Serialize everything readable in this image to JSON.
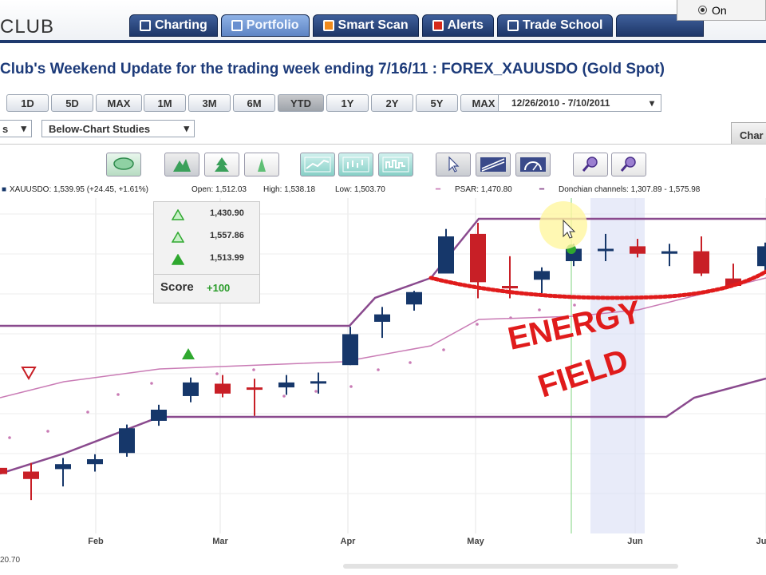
{
  "app": {
    "logo": "CLUB"
  },
  "nav": {
    "tabs": [
      {
        "label": "Charting",
        "active": false
      },
      {
        "label": "Portfolio",
        "active": true
      },
      {
        "label": "Smart Scan",
        "active": false
      },
      {
        "label": "Alerts",
        "active": false
      },
      {
        "label": "Trade School",
        "active": false
      }
    ],
    "corner_option": "On"
  },
  "page": {
    "title": "Club's Weekend Update for the trading week ending 7/16/11 : FOREX_XAUUSDO (Gold Spot)"
  },
  "range_buttons_left": [
    "1D",
    "5D",
    "MAX"
  ],
  "range_buttons": [
    {
      "label": "1M",
      "active": false
    },
    {
      "label": "3M",
      "active": false
    },
    {
      "label": "6M",
      "active": false
    },
    {
      "label": "YTD",
      "active": true
    },
    {
      "label": "1Y",
      "active": false
    },
    {
      "label": "2Y",
      "active": false
    },
    {
      "label": "5Y",
      "active": false
    },
    {
      "label": "MAX",
      "active": false
    }
  ],
  "date_range": "12/26/2010 - 7/10/2011",
  "studies": {
    "above": "s",
    "below": "Below-Chart Studies"
  },
  "side_tab": "Char",
  "legend": {
    "symbol": "XAUUSDO: 1,539.95 (+24.45, +1.61%)",
    "open": "Open: 1,512.03",
    "high": "High: 1,538.18",
    "low": "Low: 1,503.70",
    "psar": "PSAR: 1,470.80",
    "donchian": "Donchian channels: 1,307.89 - 1,575.98"
  },
  "score_panel": {
    "rows": [
      "1,430.90",
      "1,557.86",
      "1,513.99"
    ],
    "label": "Score",
    "value": "+100"
  },
  "annotation": {
    "line1": "ENERGY",
    "line2": "FIELD"
  },
  "colors": {
    "nav": "#1d3668",
    "up": "#16376a",
    "down": "#c81f26",
    "psar": "#c97bb5",
    "donchian": "#8a4a8e",
    "annotation": "#e01b1b"
  },
  "chart_data": {
    "type": "candlestick",
    "x_ticks": [
      "Feb",
      "Mar",
      "Apr",
      "May",
      "Jun",
      "Ju"
    ],
    "bottom_value": "20.70",
    "candles": [
      {
        "o": 1333,
        "h": 1345,
        "l": 1318,
        "c": 1328
      },
      {
        "o": 1330,
        "h": 1337,
        "l": 1307,
        "c": 1324
      },
      {
        "o": 1332,
        "h": 1341,
        "l": 1318,
        "c": 1336
      },
      {
        "o": 1336,
        "h": 1344,
        "l": 1330,
        "c": 1340
      },
      {
        "o": 1345,
        "h": 1368,
        "l": 1342,
        "c": 1365
      },
      {
        "o": 1371,
        "h": 1384,
        "l": 1367,
        "c": 1380
      },
      {
        "o": 1391,
        "h": 1406,
        "l": 1386,
        "c": 1402
      },
      {
        "o": 1401,
        "h": 1408,
        "l": 1390,
        "c": 1393
      },
      {
        "o": 1398,
        "h": 1405,
        "l": 1375,
        "c": 1397
      },
      {
        "o": 1398,
        "h": 1408,
        "l": 1392,
        "c": 1402
      },
      {
        "o": 1403,
        "h": 1410,
        "l": 1393,
        "c": 1403
      },
      {
        "o": 1416,
        "h": 1447,
        "l": 1416,
        "c": 1441
      },
      {
        "o": 1451,
        "h": 1463,
        "l": 1438,
        "c": 1457
      },
      {
        "o": 1465,
        "h": 1476,
        "l": 1460,
        "c": 1475
      },
      {
        "o": 1490,
        "h": 1526,
        "l": 1490,
        "c": 1520
      },
      {
        "o": 1522,
        "h": 1531,
        "l": 1470,
        "c": 1483
      },
      {
        "o": 1480,
        "h": 1504,
        "l": 1470,
        "c": 1478
      },
      {
        "o": 1485,
        "h": 1495,
        "l": 1474,
        "c": 1492
      },
      {
        "o": 1500,
        "h": 1514,
        "l": 1496,
        "c": 1510
      },
      {
        "o": 1510,
        "h": 1522,
        "l": 1500,
        "c": 1510
      },
      {
        "o": 1512,
        "h": 1518,
        "l": 1503,
        "c": 1506
      },
      {
        "o": 1506,
        "h": 1514,
        "l": 1496,
        "c": 1508
      },
      {
        "o": 1508,
        "h": 1520,
        "l": 1488,
        "c": 1490
      },
      {
        "o": 1486,
        "h": 1498,
        "l": 1480,
        "c": 1480
      },
      {
        "o": 1496,
        "h": 1515,
        "l": 1492,
        "c": 1512
      }
    ]
  }
}
